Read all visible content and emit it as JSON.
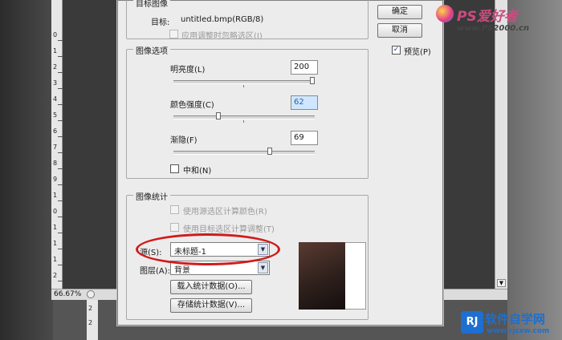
{
  "canvas": {
    "zoom": "66.67%",
    "ruler_numbers": [
      "0",
      "1",
      "2",
      "3",
      "4",
      "5",
      "6",
      "7",
      "8",
      "9",
      "1",
      "0",
      "1",
      "1",
      "1",
      "2"
    ]
  },
  "dialog": {
    "target_group_title": "目标图像",
    "target_label": "目标:",
    "target_value": "untitled.bmp(RGB/8)",
    "ignore_selection_label": "应用调整时忽略选区(I)",
    "image_options_title": "图像选项",
    "luminance_label": "明亮度(L)",
    "luminance_value": "200",
    "luminance_pct": 1.0,
    "color_intensity_label": "颜色强度(C)",
    "color_intensity_value": "62",
    "color_intensity_pct": 0.31,
    "fade_label": "渐隐(F)",
    "fade_value": "69",
    "fade_pct": 0.69,
    "neutralize_label": "中和(N)",
    "stats_title": "图像统计",
    "use_source_selection_label": "使用源选区计算颜色(R)",
    "use_target_selection_label": "使用目标选区计算调整(T)",
    "source_label": "源(S):",
    "source_value": "未标题-1",
    "layer_label": "图层(A):",
    "layer_value": "背景",
    "load_stats_label": "载入统计数据(O)...",
    "save_stats_label": "存储统计数据(V)...",
    "ok_label": "确定",
    "cancel_label": "取消",
    "preview_label": "预览(P)",
    "preview_checked": true
  },
  "watermarks": {
    "top": "PS爱好者",
    "top_url": "www.PS2000.cn",
    "bottom": "软件自学网",
    "bottom_url": "www.rjzxw.com"
  },
  "colors": {
    "annotation_red": "#d11a1a",
    "selection_blue": "#cfe6ff"
  }
}
